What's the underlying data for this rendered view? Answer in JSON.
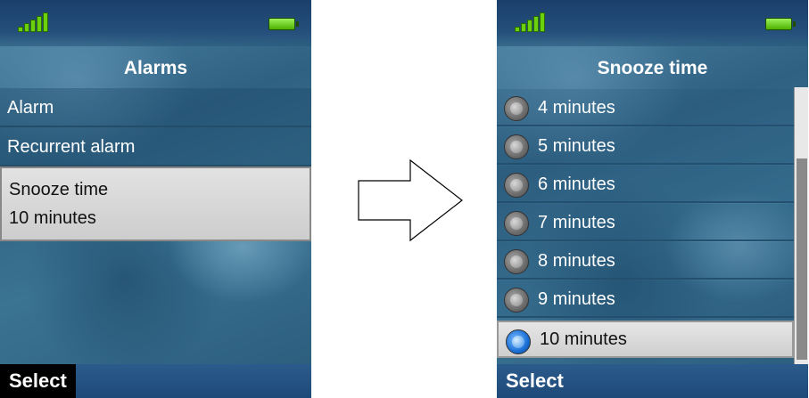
{
  "left_screen": {
    "title": "Alarms",
    "items": [
      {
        "label": "Alarm"
      },
      {
        "label": "Recurrent alarm"
      },
      {
        "label": "Snooze time",
        "value": "10 minutes"
      }
    ],
    "softkey": "Select"
  },
  "right_screen": {
    "title": "Snooze time",
    "options": [
      {
        "label": "4 minutes",
        "selected": false
      },
      {
        "label": "5 minutes",
        "selected": false
      },
      {
        "label": "6 minutes",
        "selected": false
      },
      {
        "label": "7 minutes",
        "selected": false
      },
      {
        "label": "8 minutes",
        "selected": false
      },
      {
        "label": "9 minutes",
        "selected": false
      },
      {
        "label": "10 minutes",
        "selected": true
      }
    ],
    "softkey": "Select"
  },
  "icons": {
    "signal": "signal-strength-icon",
    "battery": "battery-icon",
    "arrow": "right-arrow-icon",
    "radio": "radio-button-icon"
  },
  "colors": {
    "signal": "#6ad10c",
    "battery": "#4db100",
    "selected_radio": "#1a6fd6"
  }
}
